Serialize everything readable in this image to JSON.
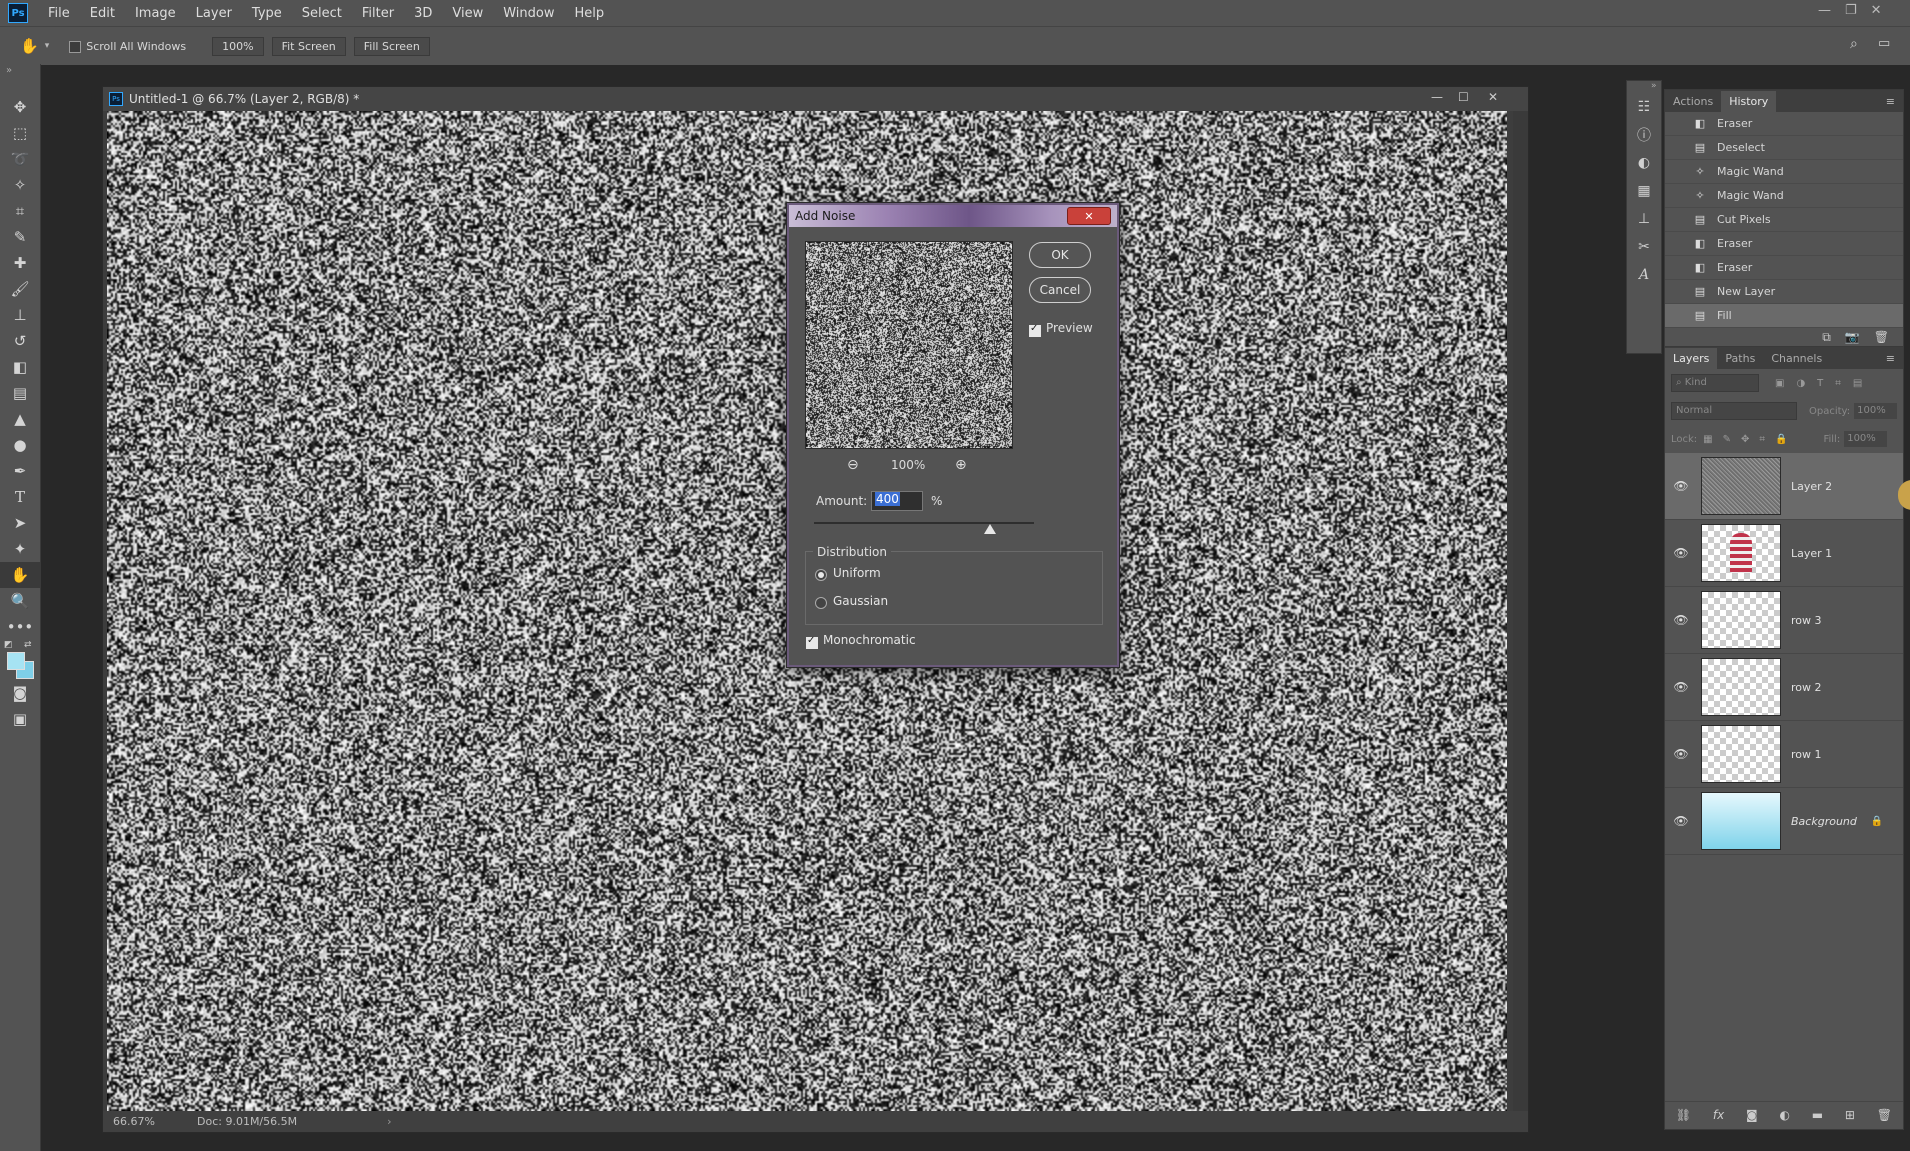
{
  "menubar": {
    "logo": "Ps",
    "items": [
      "File",
      "Edit",
      "Image",
      "Layer",
      "Type",
      "Select",
      "Filter",
      "3D",
      "View",
      "Window",
      "Help"
    ]
  },
  "options": {
    "scroll_all_windows": "Scroll All Windows",
    "zoom": "100%",
    "fit_screen": "Fit Screen",
    "fill_screen": "Fill Screen"
  },
  "document": {
    "title": "Untitled-1 @ 66.7% (Layer 2, RGB/8) *",
    "zoom": "66.67%",
    "doc_size": "Doc: 9.01M/56.5M"
  },
  "dialog": {
    "title": "Add Noise",
    "ok": "OK",
    "cancel": "Cancel",
    "preview": "Preview",
    "preview_zoom": "100%",
    "amount_label": "Amount:",
    "amount_value": "400",
    "amount_unit": "%",
    "amount_fraction": 0.8,
    "distribution_label": "Distribution",
    "uniform": "Uniform",
    "gaussian": "Gaussian",
    "monochromatic": "Monochromatic"
  },
  "history": {
    "tabs": [
      "Actions",
      "History"
    ],
    "items": [
      {
        "label": "Eraser",
        "icon": "eraser-icon"
      },
      {
        "label": "Deselect",
        "icon": "document-icon"
      },
      {
        "label": "Magic Wand",
        "icon": "magic-wand-icon"
      },
      {
        "label": "Magic Wand",
        "icon": "magic-wand-icon"
      },
      {
        "label": "Cut Pixels",
        "icon": "document-icon"
      },
      {
        "label": "Eraser",
        "icon": "eraser-icon"
      },
      {
        "label": "Eraser",
        "icon": "eraser-icon"
      },
      {
        "label": "New Layer",
        "icon": "document-icon"
      },
      {
        "label": "Fill",
        "icon": "document-icon"
      }
    ]
  },
  "layers": {
    "tabs": [
      "Layers",
      "Paths",
      "Channels"
    ],
    "kind_placeholder": "Kind",
    "blend_mode": "Normal",
    "opacity_label": "Opacity:",
    "opacity_value": "100%",
    "lock_label": "Lock:",
    "fill_label": "Fill:",
    "fill_value": "100%",
    "items": [
      {
        "name": "Layer 2",
        "thumb": "noise"
      },
      {
        "name": "Layer 1",
        "thumb": "person"
      },
      {
        "name": "row 3",
        "thumb": "transparent"
      },
      {
        "name": "row 2",
        "thumb": "transparent"
      },
      {
        "name": "row 1",
        "thumb": "transparent"
      },
      {
        "name": "Background",
        "thumb": "gradient"
      }
    ]
  },
  "colors": {
    "foreground": "#a6e3f3",
    "background": "#7ecfe8"
  }
}
